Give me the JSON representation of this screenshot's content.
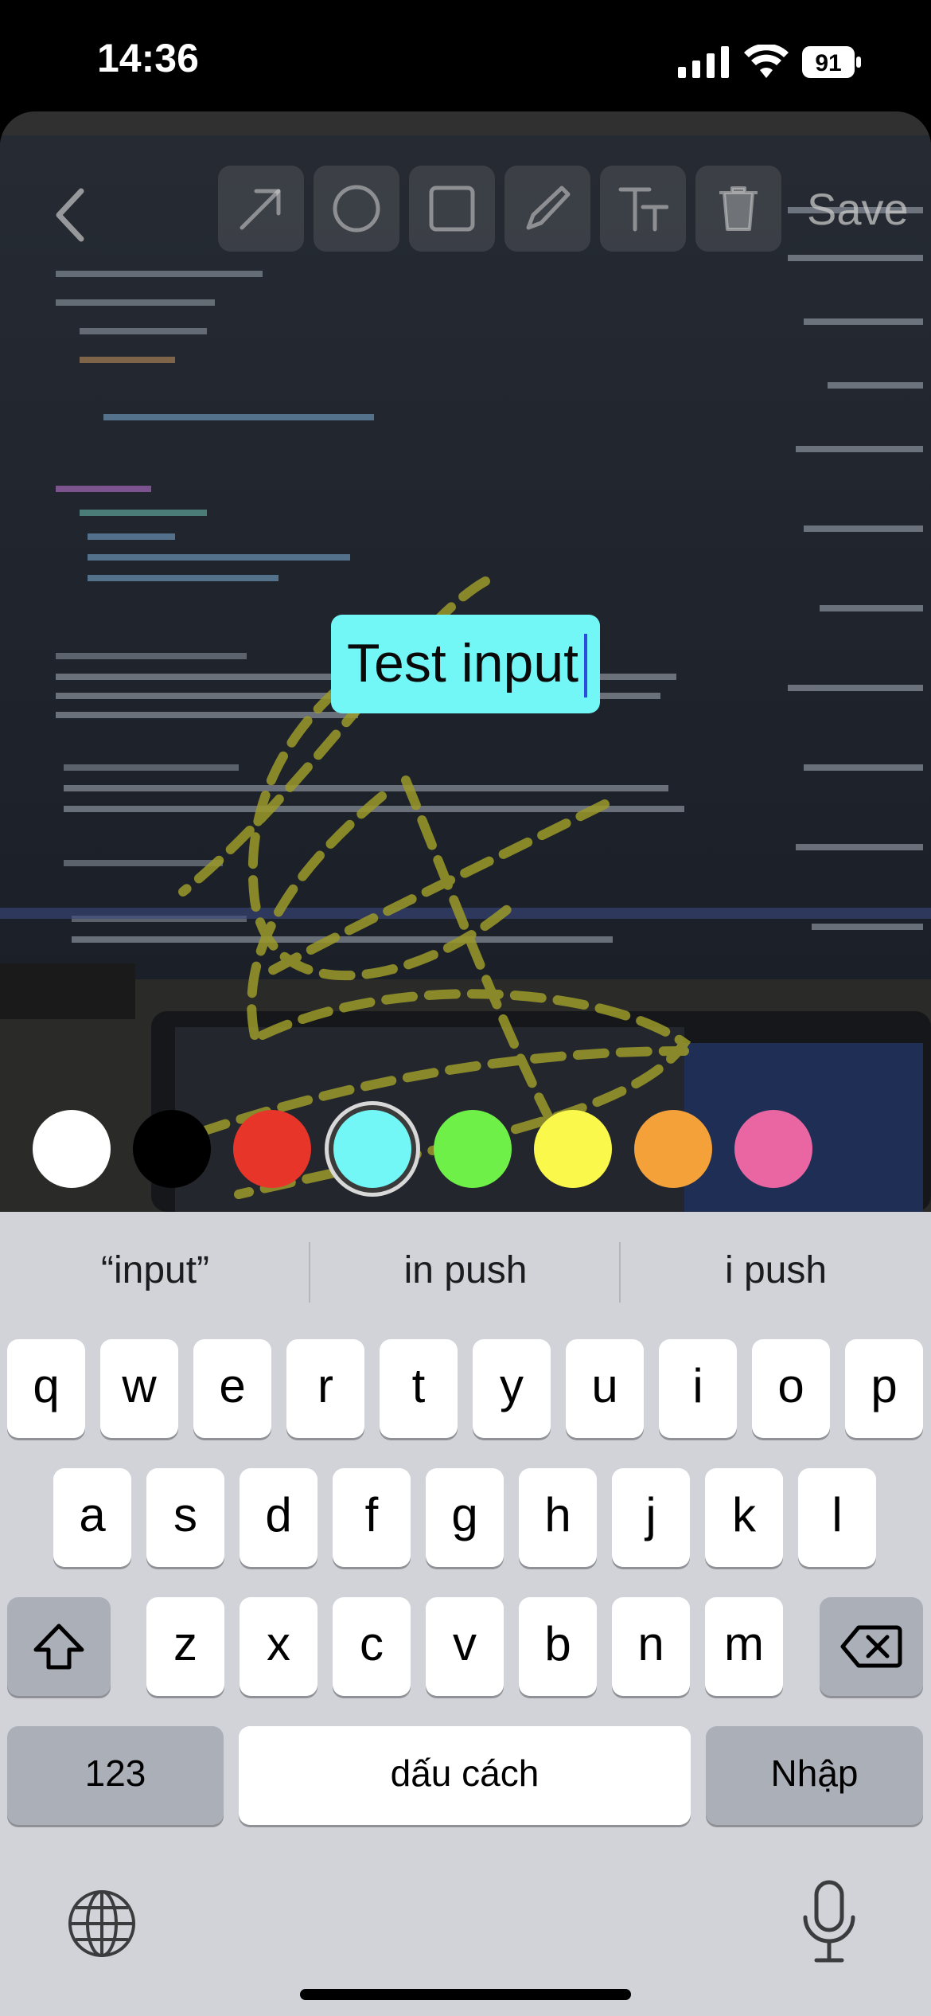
{
  "status_bar": {
    "time": "14:36",
    "battery": "91"
  },
  "editor": {
    "save_label": "Save",
    "text_input_value": "Test input",
    "tools": [
      "arrow-icon",
      "circle-icon",
      "square-icon",
      "pen-icon",
      "text-icon",
      "trash-icon"
    ],
    "colors": [
      "#ffffff",
      "#000000",
      "#e8352a",
      "#72f7f6",
      "#6ef048",
      "#fbf84c",
      "#f4a13a",
      "#e966a3"
    ],
    "selected_color": "#72f7f6"
  },
  "keyboard": {
    "suggestions": [
      "“input”",
      "in push",
      "i push"
    ],
    "row1": [
      "q",
      "w",
      "e",
      "r",
      "t",
      "y",
      "u",
      "i",
      "o",
      "p"
    ],
    "row2": [
      "a",
      "s",
      "d",
      "f",
      "g",
      "h",
      "j",
      "k",
      "l"
    ],
    "row3": [
      "z",
      "x",
      "c",
      "v",
      "b",
      "n",
      "m"
    ],
    "numbers_label": "123",
    "space_label": "dấu cách",
    "return_label": "Nhập"
  }
}
